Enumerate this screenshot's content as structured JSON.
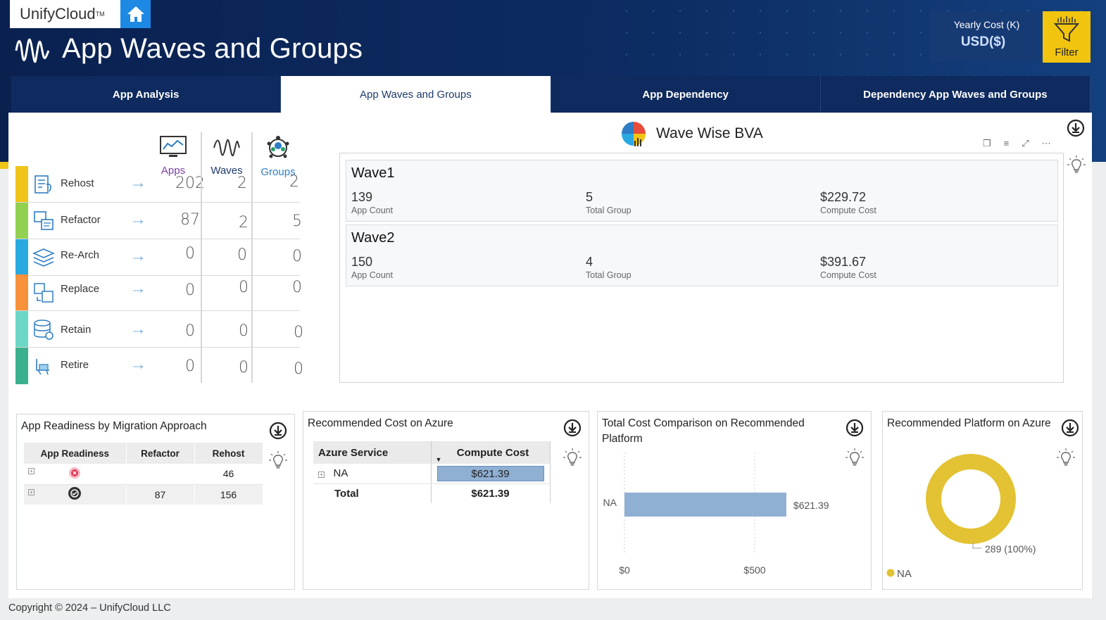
{
  "brand": {
    "name": "UnifyCloud",
    "tm": "TM"
  },
  "page_title": "App Waves and Groups",
  "yearly_cost": {
    "label": "Yearly Cost (K)",
    "value": "USD($)"
  },
  "filter_label": "Filter",
  "tabs": [
    {
      "label": "App Analysis"
    },
    {
      "label": "App Waves and Groups"
    },
    {
      "label": "App Dependency"
    },
    {
      "label": "Dependency App Waves and Groups"
    }
  ],
  "summary": {
    "headers": {
      "apps": "Apps",
      "waves": "Waves",
      "groups": "Groups"
    },
    "header_colors": {
      "apps": "#7b3fa8",
      "waves": "#1d3a6b",
      "groups": "#2e7dc4"
    },
    "rows": [
      {
        "label": "Rehost",
        "apps": "202",
        "waves": "2",
        "groups": "2",
        "color": "#f0c419",
        "icon": "rehost-icon"
      },
      {
        "label": "Refactor",
        "apps": "87",
        "waves": "2",
        "groups": "5",
        "color": "#92d050",
        "icon": "refactor-icon"
      },
      {
        "label": "Re-Arch",
        "apps": "0",
        "waves": "0",
        "groups": "0",
        "color": "#29a9e0",
        "icon": "rearch-icon"
      },
      {
        "label": "Replace",
        "apps": "0",
        "waves": "0",
        "groups": "0",
        "color": "#f7923a",
        "icon": "replace-icon"
      },
      {
        "label": "Retain",
        "apps": "0",
        "waves": "0",
        "groups": "0",
        "color": "#6ad8c5",
        "icon": "retain-icon"
      },
      {
        "label": "Retire",
        "apps": "0",
        "waves": "0",
        "groups": "0",
        "color": "#3bb08f",
        "icon": "retire-icon"
      }
    ]
  },
  "bva": {
    "title": "Wave Wise BVA",
    "waves": [
      {
        "name": "Wave1",
        "app_count": "139",
        "app_count_label": "App Count",
        "total_group": "5",
        "total_group_label": "Total Group",
        "compute_cost": "$229.72",
        "compute_cost_label": "Compute Cost"
      },
      {
        "name": "Wave2",
        "app_count": "150",
        "app_count_label": "App Count",
        "total_group": "4",
        "total_group_label": "Total Group",
        "compute_cost": "$391.67",
        "compute_cost_label": "Compute Cost"
      }
    ]
  },
  "readiness": {
    "title": "App Readiness by Migration Approach",
    "columns": [
      "App Readiness",
      "Refactor",
      "Rehost"
    ],
    "rows": [
      {
        "status_icon": "not-ready-icon",
        "refactor": "",
        "rehost": "46"
      },
      {
        "status_icon": "ready-icon",
        "refactor": "87",
        "rehost": "156"
      }
    ]
  },
  "azure_cost": {
    "title": "Recommended Cost on Azure",
    "columns": [
      "Azure Service",
      "Compute Cost"
    ],
    "rows": [
      {
        "service": "NA",
        "cost": "$621.39"
      }
    ],
    "total_label": "Total",
    "total_value": "$621.39"
  },
  "comparison": {
    "title": "Total Cost Comparison on Recommended Platform",
    "chart_data": {
      "type": "bar",
      "orientation": "horizontal",
      "categories": [
        "NA"
      ],
      "values": [
        621.39
      ],
      "data_labels": [
        "$621.39"
      ],
      "xticks": [
        "$0",
        "$500"
      ],
      "xlim": [
        0,
        850
      ],
      "color": "#8fafd3"
    }
  },
  "platform": {
    "title": "Recommended Platform on Azure",
    "chart_data": {
      "type": "pie",
      "style": "donut",
      "categories": [
        "NA"
      ],
      "values": [
        289
      ],
      "data_label": "289 (100%)",
      "legend": [
        {
          "name": "NA",
          "color": "#e3c233"
        }
      ]
    }
  },
  "footer": "Copyright © 2024 – UnifyCloud LLC"
}
